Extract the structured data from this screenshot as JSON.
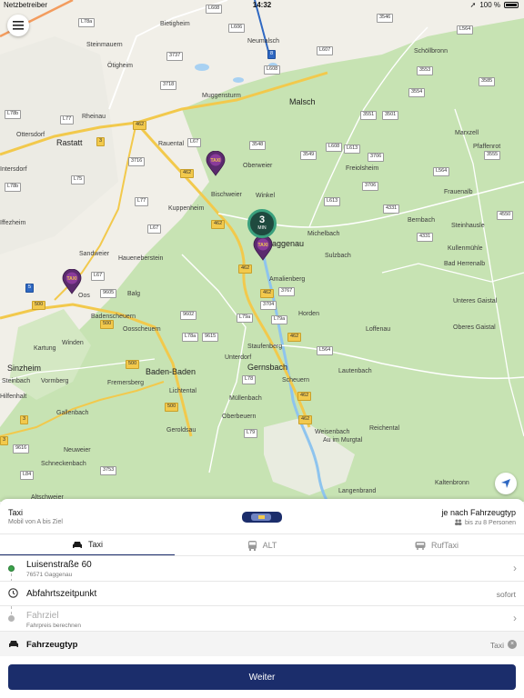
{
  "status_bar": {
    "carrier": "Netzbetreiber",
    "time": "14:32",
    "battery": "100 %"
  },
  "map": {
    "places": [
      {
        "name": "Bietigheim",
        "big": false
      },
      {
        "name": "Neumalsch",
        "big": false
      },
      {
        "name": "Steinmauern",
        "big": false
      },
      {
        "name": "Ötigheim",
        "big": false
      },
      {
        "name": "Rheinau",
        "big": false
      },
      {
        "name": "Muggensturm",
        "big": false
      },
      {
        "name": "Malsch",
        "big": true
      },
      {
        "name": "Schöllbronn",
        "big": false
      },
      {
        "name": "Ottersdorf",
        "big": false
      },
      {
        "name": "Rastatt",
        "big": true
      },
      {
        "name": "Rauental",
        "big": false
      },
      {
        "name": "Oberweier",
        "big": false
      },
      {
        "name": "Marxzell",
        "big": false
      },
      {
        "name": "Pfaffenrot",
        "big": false
      },
      {
        "name": "Freiolsheim",
        "big": false
      },
      {
        "name": "Bischweier",
        "big": false
      },
      {
        "name": "Winkel",
        "big": false
      },
      {
        "name": "Kuppenheim",
        "big": false
      },
      {
        "name": "Frauenalb",
        "big": false
      },
      {
        "name": "Michelbach",
        "big": false
      },
      {
        "name": "Bernbach",
        "big": false
      },
      {
        "name": "Steinhausle",
        "big": false
      },
      {
        "name": "Gaggenau",
        "big": true
      },
      {
        "name": "Sulzbach",
        "big": false
      },
      {
        "name": "Kullenmühle",
        "big": false
      },
      {
        "name": "Sandweier",
        "big": false
      },
      {
        "name": "Haueneberstein",
        "big": false
      },
      {
        "name": "Amalienberg",
        "big": false
      },
      {
        "name": "Bad Herrenalb",
        "big": false
      },
      {
        "name": "Oos",
        "big": false
      },
      {
        "name": "Balg",
        "big": false
      },
      {
        "name": "Horden",
        "big": false
      },
      {
        "name": "Unteres Gaistal",
        "big": false
      },
      {
        "name": "Badenscheuern",
        "big": false
      },
      {
        "name": "Oosscheuern",
        "big": false
      },
      {
        "name": "Oberes Gaistal",
        "big": false
      },
      {
        "name": "Loffenau",
        "big": false
      },
      {
        "name": "Kartung",
        "big": false
      },
      {
        "name": "Winden",
        "big": false
      },
      {
        "name": "Staufenberg",
        "big": false
      },
      {
        "name": "Sinzheim",
        "big": true
      },
      {
        "name": "Baden-Baden",
        "big": true
      },
      {
        "name": "Unterdorf",
        "big": false
      },
      {
        "name": "Gernsbach",
        "big": true
      },
      {
        "name": "Vormberg",
        "big": false
      },
      {
        "name": "Fremersberg",
        "big": false
      },
      {
        "name": "Scheuern",
        "big": false
      },
      {
        "name": "Lautenbach",
        "big": false
      },
      {
        "name": "Lichtental",
        "big": false
      },
      {
        "name": "Müllenbach",
        "big": false
      },
      {
        "name": "Gallenbach",
        "big": false
      },
      {
        "name": "Oberbeuern",
        "big": false
      },
      {
        "name": "Geroldsau",
        "big": false
      },
      {
        "name": "Weisenbach",
        "big": false
      },
      {
        "name": "Reichental",
        "big": false
      },
      {
        "name": "Au im Murgtal",
        "big": false
      },
      {
        "name": "Neuweier",
        "big": false
      },
      {
        "name": "Schneckenbach",
        "big": false
      },
      {
        "name": "Kaltenbronn",
        "big": false
      },
      {
        "name": "Altschweier",
        "big": false
      },
      {
        "name": "Langenbrand",
        "big": false
      },
      {
        "name": "Steinbach",
        "big": false
      },
      {
        "name": "Iffezheim",
        "big": false
      },
      {
        "name": "Intersdorf",
        "big": false
      },
      {
        "name": "Hilfenhalt",
        "big": false
      }
    ],
    "shields": [
      {
        "label": "L608",
        "type": "w"
      },
      {
        "label": "L606",
        "type": "w"
      },
      {
        "label": "L78a",
        "type": "w"
      },
      {
        "label": "3546",
        "type": "w"
      },
      {
        "label": "3737",
        "type": "w"
      },
      {
        "label": "L607",
        "type": "w"
      },
      {
        "label": "L564",
        "type": "w"
      },
      {
        "label": "8",
        "type": "b"
      },
      {
        "label": "L608",
        "type": "w"
      },
      {
        "label": "3553",
        "type": "w"
      },
      {
        "label": "3718",
        "type": "w"
      },
      {
        "label": "3554",
        "type": "w"
      },
      {
        "label": "3585",
        "type": "w"
      },
      {
        "label": "L78b",
        "type": "w"
      },
      {
        "label": "L77",
        "type": "w"
      },
      {
        "label": "462",
        "type": "y"
      },
      {
        "label": "3551",
        "type": "w"
      },
      {
        "label": "3501",
        "type": "w"
      },
      {
        "label": "3",
        "type": "y"
      },
      {
        "label": "L67",
        "type": "w"
      },
      {
        "label": "3548",
        "type": "w"
      },
      {
        "label": "L608",
        "type": "w"
      },
      {
        "label": "L613",
        "type": "w"
      },
      {
        "label": "3549",
        "type": "w"
      },
      {
        "label": "3555",
        "type": "w"
      },
      {
        "label": "3716",
        "type": "w"
      },
      {
        "label": "3706",
        "type": "w"
      },
      {
        "label": "462",
        "type": "y"
      },
      {
        "label": "L564",
        "type": "w"
      },
      {
        "label": "L75",
        "type": "w"
      },
      {
        "label": "L78b",
        "type": "w"
      },
      {
        "label": "3706",
        "type": "w"
      },
      {
        "label": "L77",
        "type": "w"
      },
      {
        "label": "L613",
        "type": "w"
      },
      {
        "label": "4331",
        "type": "w"
      },
      {
        "label": "4550",
        "type": "w"
      },
      {
        "label": "L67",
        "type": "w"
      },
      {
        "label": "462",
        "type": "y"
      },
      {
        "label": "4331",
        "type": "w"
      },
      {
        "label": "L67",
        "type": "w"
      },
      {
        "label": "462",
        "type": "y"
      },
      {
        "label": "5",
        "type": "b"
      },
      {
        "label": "9605",
        "type": "w"
      },
      {
        "label": "3767",
        "type": "w"
      },
      {
        "label": "462",
        "type": "y"
      },
      {
        "label": "500",
        "type": "y"
      },
      {
        "label": "3704",
        "type": "w"
      },
      {
        "label": "9602",
        "type": "w"
      },
      {
        "label": "L79a",
        "type": "w"
      },
      {
        "label": "L79a",
        "type": "w"
      },
      {
        "label": "500",
        "type": "y"
      },
      {
        "label": "L78a",
        "type": "w"
      },
      {
        "label": "9615",
        "type": "w"
      },
      {
        "label": "462",
        "type": "y"
      },
      {
        "label": "L564",
        "type": "w"
      },
      {
        "label": "500",
        "type": "y"
      },
      {
        "label": "L78",
        "type": "w"
      },
      {
        "label": "462",
        "type": "y"
      },
      {
        "label": "500",
        "type": "y"
      },
      {
        "label": "462",
        "type": "y"
      },
      {
        "label": "3",
        "type": "y"
      },
      {
        "label": "L79",
        "type": "w"
      },
      {
        "label": "9616",
        "type": "w"
      },
      {
        "label": "3753",
        "type": "w"
      },
      {
        "label": "L84",
        "type": "w"
      },
      {
        "label": "3",
        "type": "y"
      }
    ],
    "eta": {
      "value": "3",
      "unit": "MIN"
    },
    "taxi_label": "TAXI"
  },
  "vehicle_type": {
    "title": "Taxi",
    "subtitle": "Mobil von A bis Ziel",
    "right_title": "je nach Fahrzeugtyp",
    "seats": "bis zu 8 Personen"
  },
  "tabs": [
    {
      "label": "Taxi",
      "active": true
    },
    {
      "label": "ALT",
      "active": false
    },
    {
      "label": "RufTaxi",
      "active": false
    }
  ],
  "origin": {
    "street": "Luisenstraße 60",
    "city": "76571 Gaggenau"
  },
  "departure": {
    "label": "Abfahrtszeitpunkt",
    "value": "sofort"
  },
  "destination": {
    "placeholder": "Fahrziel",
    "hint": "Fahrpreis berechnen"
  },
  "vehicle": {
    "label": "Fahrzeugtyp",
    "value": "Taxi"
  },
  "cta": {
    "label": "Weiter"
  },
  "colors": {
    "primary": "#1b2d6b",
    "eta_bg": "#1f4a3f",
    "eta_ring": "#3aa07d",
    "forest": "#c7e3b3",
    "origin_dot": "#3aa34a"
  }
}
